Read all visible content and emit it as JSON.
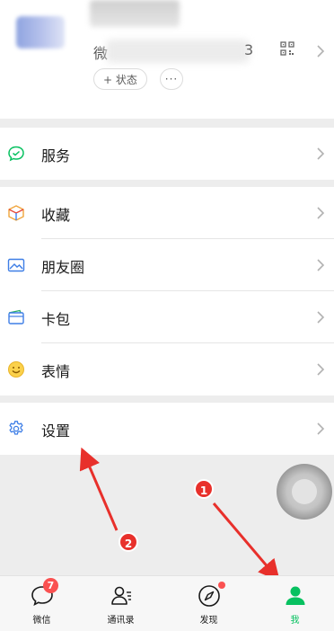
{
  "profile": {
    "wxid_prefix": "微",
    "wxid_suffix": "3",
    "status_label": "+ 状态",
    "more_label": "···"
  },
  "menu": {
    "group1": [
      {
        "label": "服务",
        "icon": "service-icon"
      }
    ],
    "group2": [
      {
        "label": "收藏",
        "icon": "favorites-icon"
      },
      {
        "label": "朋友圈",
        "icon": "moments-icon"
      },
      {
        "label": "卡包",
        "icon": "card-wallet-icon"
      },
      {
        "label": "表情",
        "icon": "sticker-icon"
      }
    ],
    "group3": [
      {
        "label": "设置",
        "icon": "settings-gear-icon"
      }
    ]
  },
  "tabbar": {
    "tabs": [
      {
        "label": "微信",
        "icon": "chat-icon",
        "badge": "7"
      },
      {
        "label": "通讯录",
        "icon": "contacts-icon"
      },
      {
        "label": "发现",
        "icon": "compass-icon"
      },
      {
        "label": "我",
        "icon": "me-person-icon"
      }
    ]
  },
  "annotations": {
    "marker1": "1",
    "marker2": "2"
  },
  "colors": {
    "accent_green": "#07c160",
    "badge_red": "#fa5151",
    "annotation_red": "#e8302b"
  }
}
